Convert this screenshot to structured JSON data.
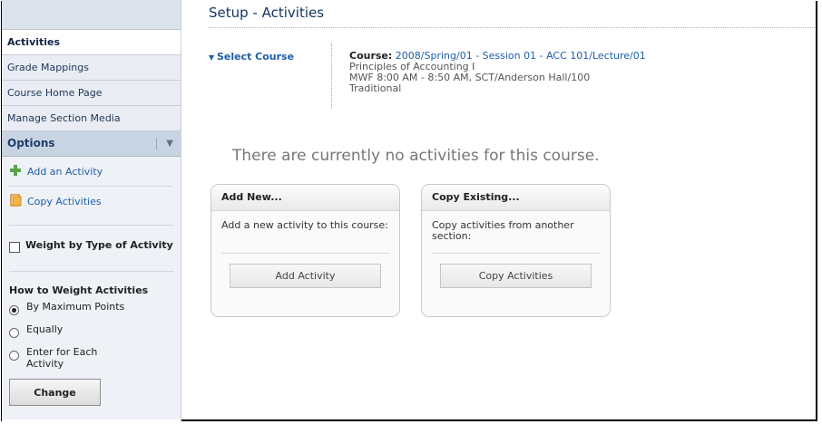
{
  "sidebar": {
    "items": [
      {
        "label": "Activities"
      },
      {
        "label": "Grade Mappings"
      },
      {
        "label": "Course Home Page"
      },
      {
        "label": "Manage Section Media"
      }
    ],
    "options": {
      "title": "Options",
      "links": [
        {
          "label": "Add an Activity",
          "icon": "plus-icon"
        },
        {
          "label": "Copy Activities",
          "icon": "copy-icon"
        }
      ],
      "weight_checkbox": "Weight by Type of Activity",
      "howto_title": "How to Weight Activities",
      "radios": [
        {
          "label": "By Maximum Points",
          "selected": true
        },
        {
          "label": "Equally",
          "selected": false
        },
        {
          "label": "Enter for Each Activity",
          "selected": false
        }
      ],
      "change_button": "Change"
    }
  },
  "main": {
    "title": "Setup - Activities",
    "select_course": "Select Course",
    "course": {
      "label": "Course:",
      "value": "2008/Spring/01 - Session 01 - ACC 101/Lecture/01",
      "name": "Principles of Accounting I",
      "schedule": "MWF 8:00 AM - 8:50 AM, SCT/Anderson Hall/100",
      "type": "Traditional"
    },
    "empty_message": "There are currently no activities for this course.",
    "cards": [
      {
        "title": "Add New...",
        "text": "Add a new activity to this course:",
        "button": "Add Activity"
      },
      {
        "title": "Copy Existing...",
        "text": "Copy activities from another section:",
        "button": "Copy Activities"
      }
    ]
  }
}
